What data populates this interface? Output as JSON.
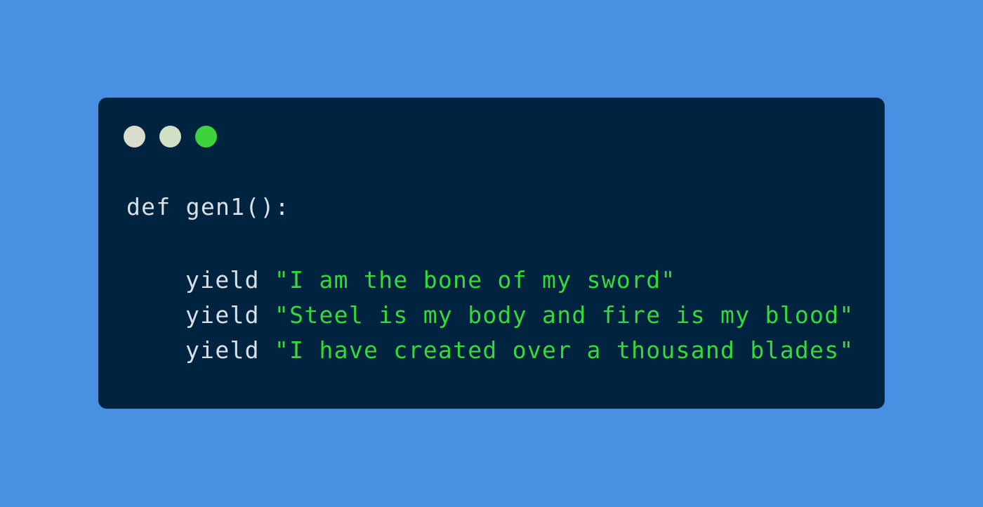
{
  "colors": {
    "page_background": "#4a90e2",
    "window_background": "#002340",
    "dot_1": "#d7dccd",
    "dot_2": "#cfe0c4",
    "dot_3": "#3fd23f",
    "code_text": "#d8e0e8",
    "string_text": "#35d93a"
  },
  "window": {
    "controls": [
      "window-dot-1",
      "window-dot-2",
      "window-dot-3"
    ]
  },
  "code": {
    "def_line": "def gen1():",
    "lines": [
      {
        "keyword": "yield",
        "string": "\"I am the bone of my sword\""
      },
      {
        "keyword": "yield",
        "string": "\"Steel is my body and fire is my blood\""
      },
      {
        "keyword": "yield",
        "string": "\"I have created over a thousand blades\""
      }
    ]
  }
}
